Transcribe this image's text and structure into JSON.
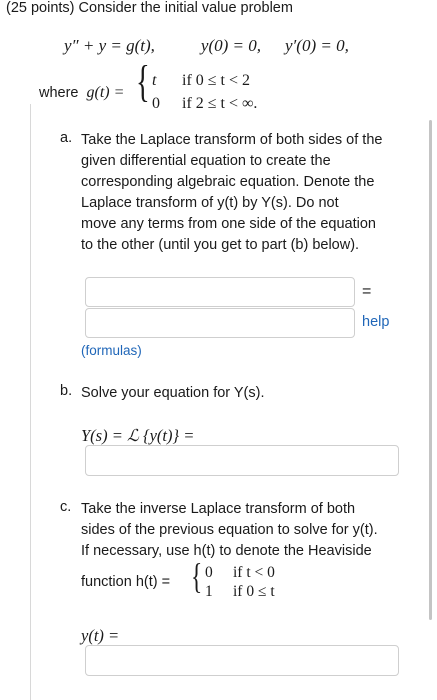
{
  "header": "(25 points) Consider the initial value problem",
  "ode": {
    "lhs": "y″ + y = g(t),",
    "ic1": "y(0) = 0,",
    "ic2": "y′(0) = 0,"
  },
  "where": {
    "prefix": "where",
    "lhs": "g(t) =",
    "case1_val": "t",
    "case1_cond": "if 0 ≤ t < 2",
    "case2_val": "0",
    "case2_cond": "if 2 ≤ t < ∞."
  },
  "part_a": {
    "letter": "a.",
    "lines": [
      "Take the Laplace transform of both sides of the",
      "given differential equation to create the",
      "corresponding algebraic equation. Denote the",
      "Laplace transform of y(t) by Y(s). Do not",
      "move any terms from one side of the equation",
      "to the other (until you get to part (b) below)."
    ],
    "equals": "=",
    "help": "help",
    "formulas": "(formulas)",
    "input1_value": "",
    "input2_value": ""
  },
  "part_b": {
    "letter": "b.",
    "text": "Solve your equation for Y(s).",
    "equation": "Y(s) = ℒ {y(t)} =",
    "input_value": ""
  },
  "part_c": {
    "letter": "c.",
    "lines": [
      "Take the inverse Laplace transform of both",
      "sides of the previous equation to solve for y(t).",
      "If necessary, use h(t) to denote the Heaviside"
    ],
    "function_prefix": "function h(t) =",
    "case1_val": "0",
    "case1_cond": "if t < 0",
    "case2_val": "1",
    "case2_cond": "if 0 ≤ t",
    "answer_label": "y(t) =",
    "input_value": ""
  }
}
